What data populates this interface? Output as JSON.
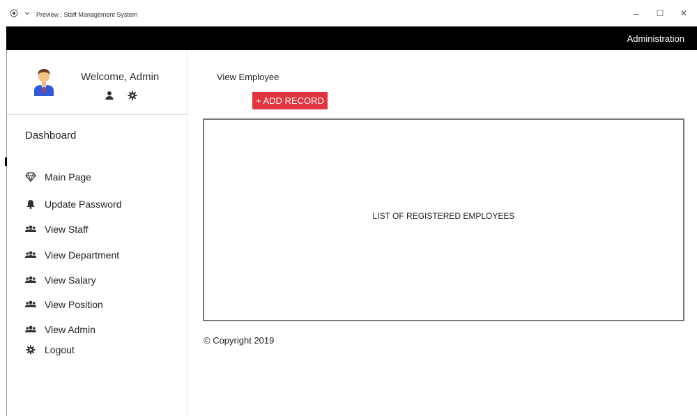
{
  "window": {
    "title": "Preview : Staff Management System",
    "controls": {
      "minimize": "–",
      "maximize": "☐",
      "close": "✕"
    }
  },
  "topbar": {
    "title": "Administration"
  },
  "profile": {
    "welcome": "Welcome, Admin",
    "icons": [
      "user-icon",
      "gear-icon"
    ]
  },
  "sidebar": {
    "heading": "Dashboard",
    "items": [
      {
        "label": "Main Page",
        "icon": "diamond-icon"
      },
      {
        "label": "Update Password",
        "icon": "bell-icon"
      },
      {
        "label": "View Staff",
        "icon": "users-icon"
      },
      {
        "label": "View Department",
        "icon": "users-icon"
      },
      {
        "label": "View Salary",
        "icon": "users-icon"
      },
      {
        "label": "View Position",
        "icon": "users-icon"
      },
      {
        "label": "View Admin",
        "icon": "users-icon"
      },
      {
        "label": "Logout",
        "icon": "gear-icon"
      }
    ]
  },
  "main": {
    "title": "View Employee",
    "add_button": "+ ADD RECORD",
    "list_placeholder": "LIST OF REGISTERED EMPLOYEES",
    "footer": "© Copyright 2019"
  },
  "colors": {
    "accent": "#e2343f",
    "topbar": "#000000",
    "box_border": "#777777"
  }
}
